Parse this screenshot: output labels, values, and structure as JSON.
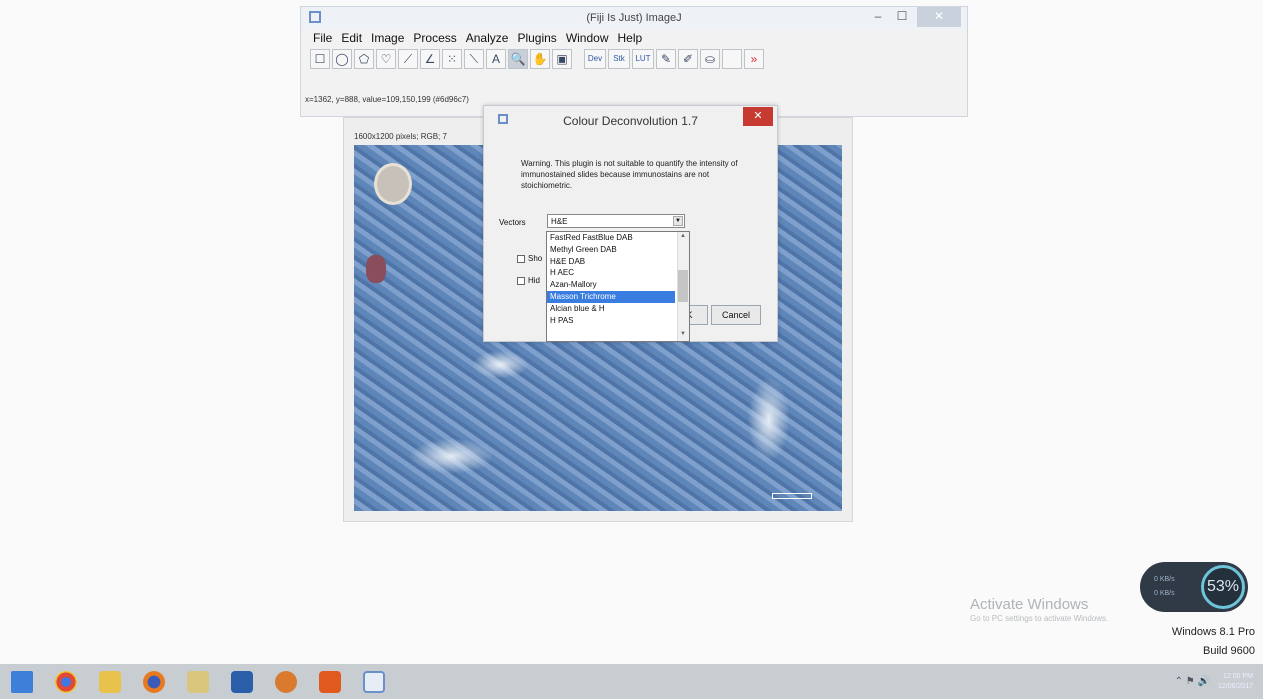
{
  "imagej": {
    "title": "(Fiji Is Just) ImageJ",
    "window_buttons": {
      "minimize": "–",
      "maximize": "☐",
      "close": "✕"
    },
    "menu": [
      "File",
      "Edit",
      "Image",
      "Process",
      "Analyze",
      "Plugins",
      "Window",
      "Help"
    ],
    "tools": [
      {
        "name": "rectangle-tool-icon",
        "glyph": "☐"
      },
      {
        "name": "oval-tool-icon",
        "glyph": "◯"
      },
      {
        "name": "polygon-tool-icon",
        "glyph": "⬠"
      },
      {
        "name": "freehand-tool-icon",
        "glyph": "♡"
      },
      {
        "name": "line-tool-icon",
        "glyph": "⟋"
      },
      {
        "name": "angle-tool-icon",
        "glyph": "∠"
      },
      {
        "name": "point-tool-icon",
        "glyph": "⁙"
      },
      {
        "name": "wand-tool-icon",
        "glyph": "⟍"
      },
      {
        "name": "text-tool-icon",
        "glyph": "A"
      },
      {
        "name": "magnifier-tool-icon",
        "glyph": "🔍"
      },
      {
        "name": "hand-tool-icon",
        "glyph": "✋"
      },
      {
        "name": "color-picker-tool-icon",
        "glyph": "▣"
      }
    ],
    "extra_tools": [
      {
        "name": "dev-tool-icon",
        "label": "Dev"
      },
      {
        "name": "stk-tool-icon",
        "label": "Stk"
      },
      {
        "name": "lut-tool-icon",
        "label": "LUT"
      },
      {
        "name": "pencil-tool-icon",
        "label": "✎"
      },
      {
        "name": "brush-tool-icon",
        "label": "✐"
      },
      {
        "name": "flood-fill-tool-icon",
        "label": "⛀"
      },
      {
        "name": "blank-tool-slot",
        "label": ""
      },
      {
        "name": "more-tools-icon",
        "label": "»"
      }
    ],
    "status": "x=1362, y=888, value=109,150,199 (#6d96c7)"
  },
  "image_window": {
    "info": "1600x1200 pixels; RGB; 7"
  },
  "dialog": {
    "title": "Colour Deconvolution 1.7",
    "close": "✕",
    "warning": "Warning. This plugin is not suitable to quantify the intensity of immunostained slides because immunostains are not stoichiometric.",
    "vectors_label": "Vectors",
    "vectors_value": "H&E",
    "checkbox_1": "Sho",
    "checkbox_2": "Hid",
    "ok": "OK",
    "cancel": "Cancel",
    "dropdown_options": [
      "FastRed FastBlue DAB",
      "Methyl Green DAB",
      "H&E DAB",
      "H AEC",
      "Azan-Mallory",
      "Masson Trichrome",
      "Alcian blue & H",
      "H PAS"
    ],
    "dropdown_selected": "Masson Trichrome"
  },
  "watermark": {
    "title": "Activate Windows",
    "subtitle": "Go to PC settings to activate Windows."
  },
  "os": {
    "name": "Windows 8.1 Pro",
    "build": "Build 9600"
  },
  "widget": {
    "upload": "0 KB/s",
    "download": "0 KB/s",
    "gauge": "53%"
  },
  "taskbar": {
    "apps": [
      "start",
      "chrome",
      "explorer",
      "firefox",
      "files",
      "photoshop",
      "media-player",
      "office",
      "fiji"
    ],
    "clock_time": "12:00 PM",
    "clock_date": "12/06/2017"
  }
}
